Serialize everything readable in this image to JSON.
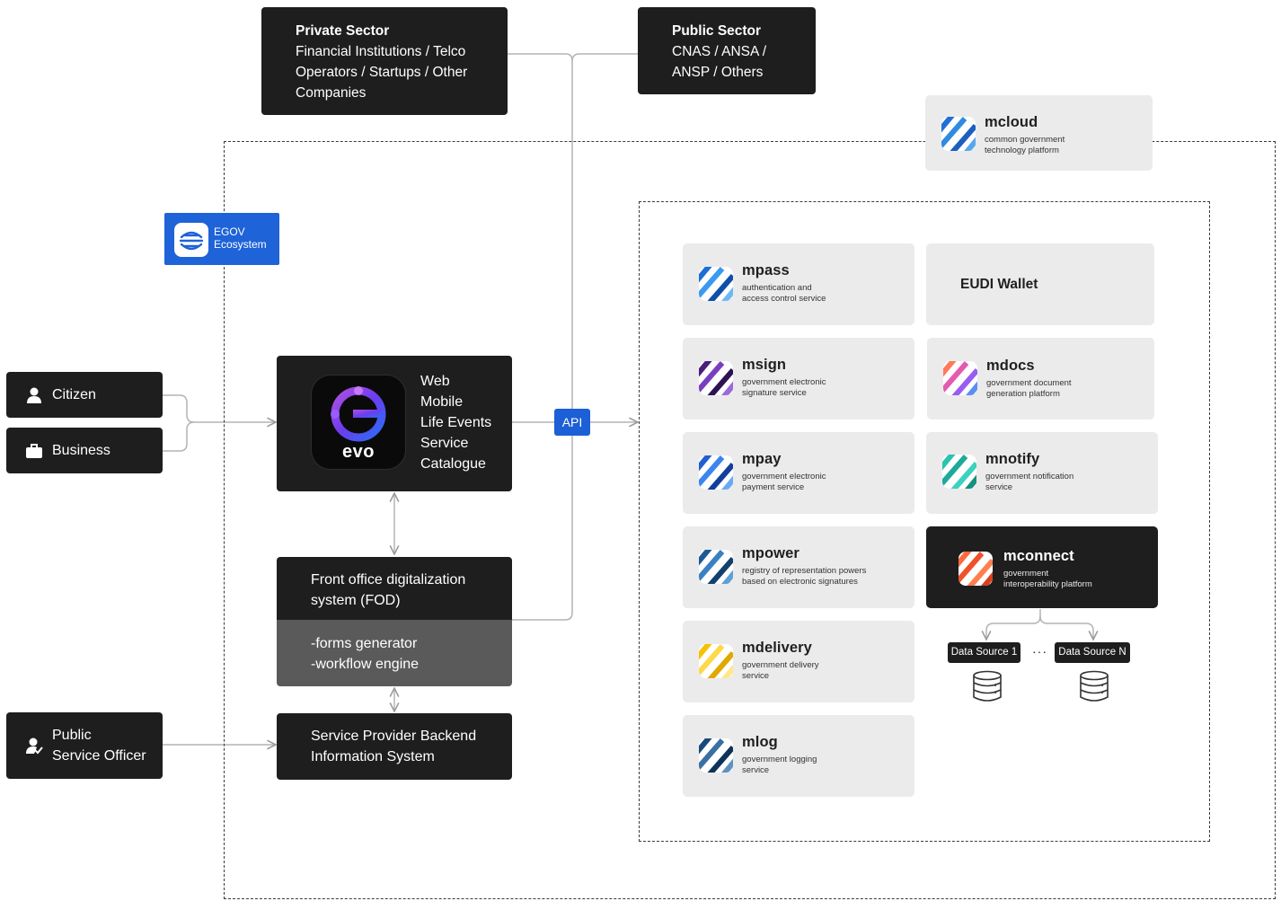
{
  "private_sector": {
    "title": "Private Sector",
    "description": "Financial Institutions / Telco\nOperators / Startups / Other\nCompanies"
  },
  "public_sector": {
    "title": "Public Sector",
    "description": "CNAS / ANSA /\nANSP / Others"
  },
  "mcloud": {
    "name": "mcloud",
    "description": "common government\ntechnology platform",
    "icon": "mcloud-stripe-icon"
  },
  "egov": {
    "label": "EGOV\nEcosystem",
    "icon": "egov-logo-icon"
  },
  "actors": {
    "citizen": "Citizen",
    "business": "Business",
    "officer": "Public\nService Officer"
  },
  "evo": {
    "logo_text": "evo",
    "items": [
      "Web",
      "Mobile",
      "Life Events",
      "Service",
      "Catalogue"
    ]
  },
  "api_label": "API",
  "fod": {
    "title": "Front office digitalization\nsystem (FOD)",
    "details": "-forms generator\n-workflow engine"
  },
  "backend": {
    "title": "Service Provider Backend\nInformation System"
  },
  "services": [
    {
      "name": "mpass",
      "description": "authentication and\naccess control service",
      "icon": "mpass-stripe-icon",
      "color": "#2a6fb5"
    },
    {
      "name": "msign",
      "description": "government electronic\nsignature service",
      "icon": "msign-stripe-icon",
      "color": "#5a2a8a"
    },
    {
      "name": "mpay",
      "description": "government electronic\npayment service",
      "icon": "mpay-stripe-icon",
      "color": "#2f6ed2"
    },
    {
      "name": "mpower",
      "description": "registry of representation powers\nbased on electronic signatures",
      "icon": "mpower-stripe-icon",
      "color": "#2f6ea8"
    },
    {
      "name": "mdelivery",
      "description": "government delivery\nservice",
      "icon": "mdelivery-stripe-icon",
      "color": "#f2c200"
    },
    {
      "name": "mlog",
      "description": "government logging\nservice",
      "icon": "mlog-stripe-icon",
      "color": "#2a5a8a"
    }
  ],
  "eudi_wallet": "EUDI Wallet",
  "mdocs": {
    "name": "mdocs",
    "description": "government document\ngeneration platform",
    "icon": "mdocs-stripe-icon"
  },
  "mnotify": {
    "name": "mnotify",
    "description": "government notification\nservice",
    "icon": "mnotify-stripe-icon"
  },
  "mconnect": {
    "name": "mconnect",
    "description": "government\ninteroperability platform",
    "icon": "mconnect-stripe-icon"
  },
  "data_sources": {
    "first": "Data Source 1",
    "last": "Data Source N",
    "separator": "···"
  }
}
